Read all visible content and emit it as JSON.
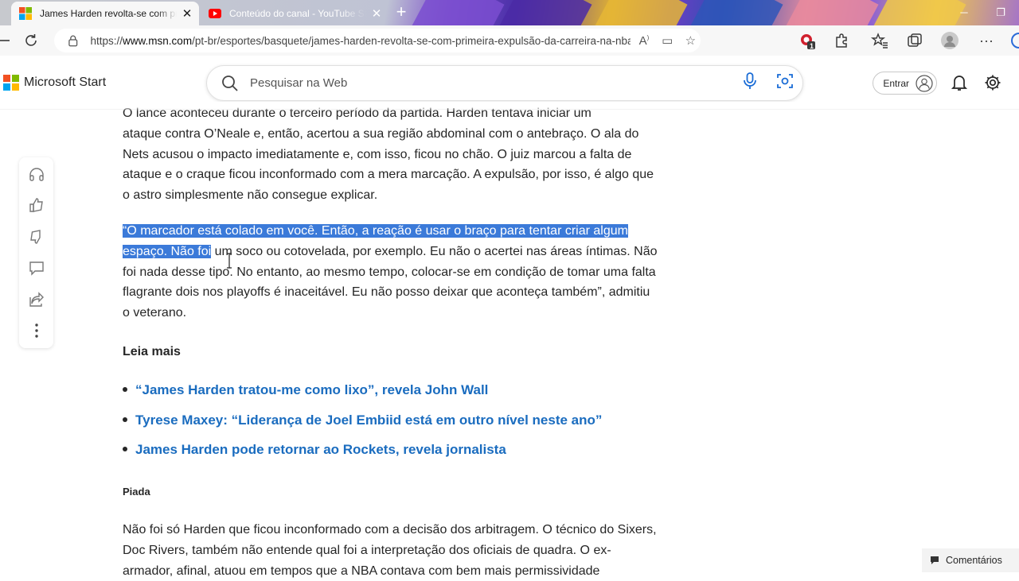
{
  "browser": {
    "tabs": [
      {
        "title": "James Harden revolta-se com primeira expulsão",
        "favicon": "microsoft-icon",
        "active": true
      },
      {
        "title": "Conteúdo do canal - YouTube Studio",
        "favicon": "youtube-icon",
        "active": false
      }
    ],
    "url_scheme": "https://",
    "url_host": "www.msn.com",
    "url_path": "/pt-br/esportes/basquete/james-harden-revolta-se-com-primeira-expulsão-da-carreira-na-nba/ar-A...",
    "extension_badge": "1"
  },
  "header": {
    "brand": "Microsoft Start",
    "search_placeholder": "Pesquisar na Web",
    "signin_label": "Entrar"
  },
  "rail": [
    "headphones-icon",
    "like-icon",
    "dislike-icon",
    "comment-icon",
    "share-icon",
    "more-icon"
  ],
  "article": {
    "para1_cut": "O lance aconteceu durante o terceiro período da partida. Harden tentava iniciar um",
    "para1": "ataque contra O’Neale e, então, acertou a sua região abdominal com o antebraço. O ala do Nets acusou o impacto imediatamente e, com isso, ficou no chão. O juiz marcou a falta de ataque e o craque ficou inconformado com a mera marcação. A expulsão, por isso, é algo que o astro simplesmente não consegue explicar.",
    "para2_selected": "“O marcador está colado em você. Então, a reação é usar o braço para tentar criar algum espaço. Não foi",
    "para2_rest": " um soco ou cotovelada, por exemplo. Eu não o acertei nas áreas íntimas. Não foi nada desse tipo. No entanto, ao mesmo tempo, colocar-se em condição de tomar uma falta flagrante dois nos playoffs é inaceitável. Eu não posso deixar que aconteça também”, admitiu o veterano.",
    "leia_mais": "Leia mais",
    "links": [
      "“James Harden tratou-me como lixo”, revela John Wall",
      "Tyrese Maxey: “Liderança de Joel Embiid está em outro nível neste ano”",
      "James Harden pode retornar ao Rockets, revela jornalista"
    ],
    "piada": "Piada",
    "para3": "Não foi só Harden que ficou inconformado com a decisão dos arbitragem. O técnico do Sixers, Doc Rivers, também não entende qual foi a interpretação dos oficiais de quadra. O ex-armador, afinal, atuou em tempos que a NBA contava com bem mais permissividade"
  },
  "comments_label": "Comentários",
  "colors": {
    "link": "#1a6cbf",
    "selection": "#3b7ad9",
    "text": "#262626"
  }
}
